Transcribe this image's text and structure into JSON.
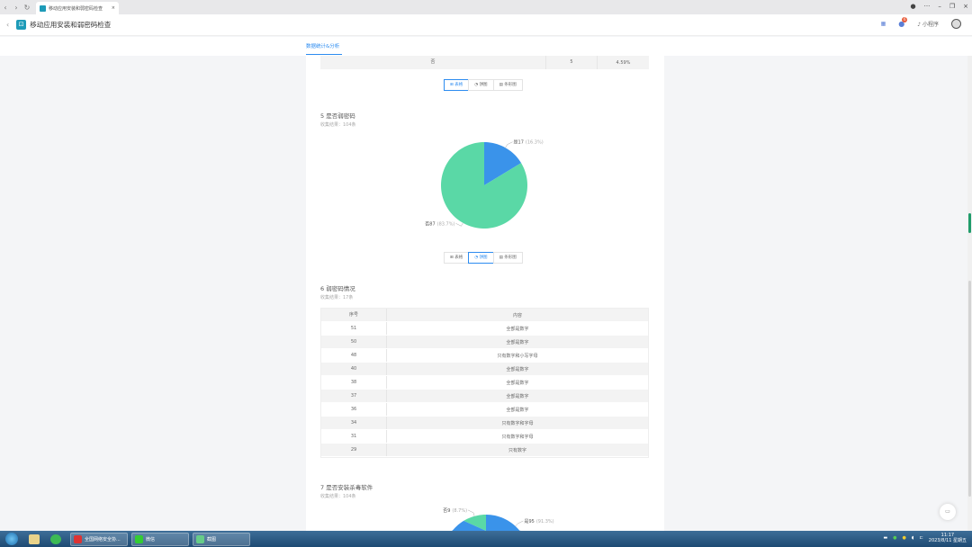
{
  "browser": {
    "tab_title": "移动应用安装和弱密码检查"
  },
  "app": {
    "title": "移动应用安装和弱密码检查",
    "mini_program": "小程序",
    "notif_count": "6"
  },
  "tabs": [
    {
      "label": "数据统计&分析"
    }
  ],
  "top_table_row": {
    "option": "否",
    "count": "5",
    "percent": "4.59%"
  },
  "view_buttons": {
    "table": "表格",
    "pie": "饼图",
    "bar": "条形图"
  },
  "q5": {
    "title": "5  是否弱密码",
    "subtitle": "收集结果：104条",
    "chart_data": {
      "type": "pie",
      "slices": [
        {
          "label": "是17",
          "value": 17,
          "pct": "(16.3%)",
          "color": "#3a93ea"
        },
        {
          "label": "否87",
          "value": 87,
          "pct": "(83.7%)",
          "color": "#5ad8a6"
        }
      ]
    }
  },
  "q6": {
    "title": "6  弱密码情况",
    "subtitle": "收集结果：17条",
    "headers": [
      "序号",
      "内容"
    ],
    "rows": [
      [
        "51",
        "全部是数字"
      ],
      [
        "50",
        "全部是数字"
      ],
      [
        "48",
        "只有数字和小写字母"
      ],
      [
        "40",
        "全部是数字"
      ],
      [
        "38",
        "全部是数字"
      ],
      [
        "37",
        "全部是数字"
      ],
      [
        "36",
        "全部是数字"
      ],
      [
        "34",
        "只有数字和字母"
      ],
      [
        "31",
        "只有数字和字母"
      ],
      [
        "29",
        "只有数字"
      ]
    ]
  },
  "q7": {
    "title": "7  是否安装杀毒软件",
    "subtitle": "收集结果：104条",
    "chart_data": {
      "type": "pie",
      "slices": [
        {
          "label": "是95",
          "value": 95,
          "pct": "(91.3%)",
          "color": "#3a93ea"
        },
        {
          "label": "否9",
          "value": 9,
          "pct": "(8.7%)",
          "color": "#5ad8a6"
        }
      ]
    }
  },
  "taskbar": {
    "items": [
      "全国网络安全协...",
      "微信",
      "截图"
    ],
    "time": "11:17",
    "date": "2023/8/11 星期五"
  }
}
